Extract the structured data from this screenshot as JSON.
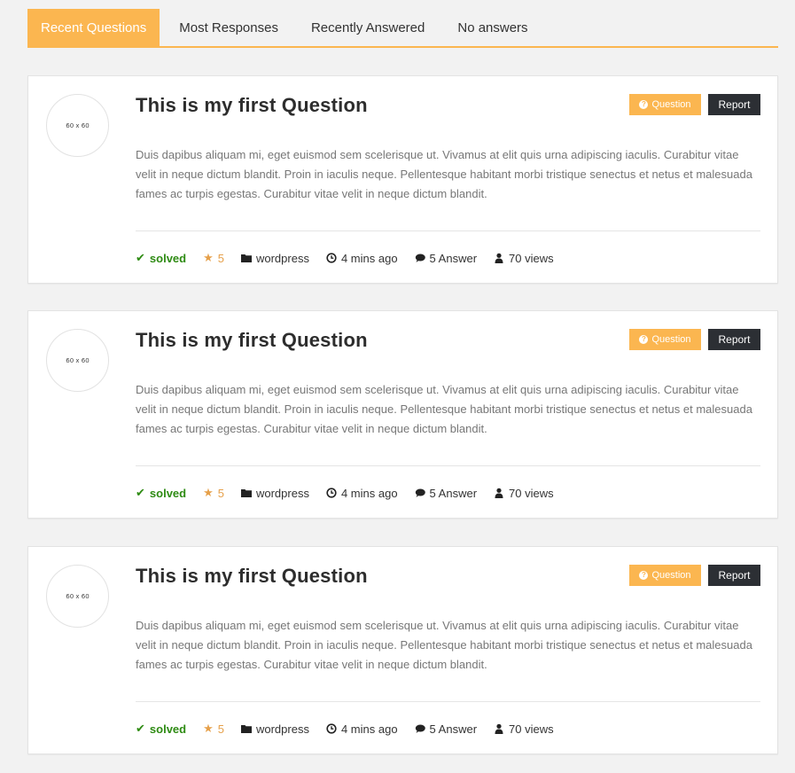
{
  "tabs": [
    {
      "label": "Recent Questions",
      "active": true
    },
    {
      "label": "Most Responses",
      "active": false
    },
    {
      "label": "Recently Answered",
      "active": false
    },
    {
      "label": "No answers",
      "active": false
    }
  ],
  "colors": {
    "accent": "#fbb650",
    "report": "#2c2f34",
    "solved": "#2e8b13",
    "star": "#e6a04a"
  },
  "questions": [
    {
      "avatar_text": "60 x 60",
      "title": "This is my first Question",
      "type_badge": "Question",
      "report_label": "Report",
      "body": "Duis dapibus aliquam mi, eget euismod sem scelerisque ut. Vivamus at elit quis urna adipiscing iaculis. Curabitur vitae velit in neque dictum blandit. Proin in iaculis neque. Pellentesque habitant morbi tristique senectus et netus et malesuada fames ac turpis egestas. Curabitur vitae velit in neque dictum blandit.",
      "status": "solved",
      "rating": "5",
      "category": "wordpress",
      "time": "4 mins ago",
      "answers": "5 Answer",
      "views": "70 views"
    },
    {
      "avatar_text": "60 x 60",
      "title": "This is my first Question",
      "type_badge": "Question",
      "report_label": "Report",
      "body": "Duis dapibus aliquam mi, eget euismod sem scelerisque ut. Vivamus at elit quis urna adipiscing iaculis. Curabitur vitae velit in neque dictum blandit. Proin in iaculis neque. Pellentesque habitant morbi tristique senectus et netus et malesuada fames ac turpis egestas. Curabitur vitae velit in neque dictum blandit.",
      "status": "solved",
      "rating": "5",
      "category": "wordpress",
      "time": "4 mins ago",
      "answers": "5 Answer",
      "views": "70 views"
    },
    {
      "avatar_text": "60 x 60",
      "title": "This is my first Question",
      "type_badge": "Question",
      "report_label": "Report",
      "body": "Duis dapibus aliquam mi, eget euismod sem scelerisque ut. Vivamus at elit quis urna adipiscing iaculis. Curabitur vitae velit in neque dictum blandit. Proin in iaculis neque. Pellentesque habitant morbi tristique senectus et netus et malesuada fames ac turpis egestas. Curabitur vitae velit in neque dictum blandit.",
      "status": "solved",
      "rating": "5",
      "category": "wordpress",
      "time": "4 mins ago",
      "answers": "5 Answer",
      "views": "70 views"
    }
  ]
}
